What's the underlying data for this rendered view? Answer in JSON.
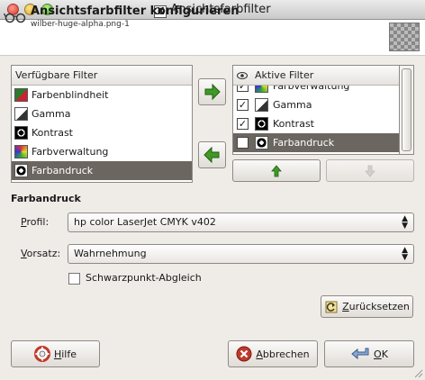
{
  "window": {
    "title": "Ansichtsfarbfilter"
  },
  "header": {
    "title": "Ansichtsfarbfilter konfigurieren",
    "subtitle": "wilber-huge-alpha.png-1"
  },
  "available": {
    "column_header": "Verfügbare Filter",
    "items": [
      {
        "label": "Farbenblindheit",
        "icon": "colorblind-icon",
        "selected": false
      },
      {
        "label": "Gamma",
        "icon": "gamma-icon",
        "selected": false
      },
      {
        "label": "Kontrast",
        "icon": "contrast-icon",
        "selected": false
      },
      {
        "label": "Farbverwaltung",
        "icon": "color-management-icon",
        "selected": false
      },
      {
        "label": "Farbandruck",
        "icon": "proof-icon",
        "selected": true
      }
    ]
  },
  "active": {
    "column_header": "Aktive Filter",
    "items": [
      {
        "label": "Farbverwaltung",
        "checked": true,
        "selected": false
      },
      {
        "label": "Gamma",
        "checked": true,
        "selected": false
      },
      {
        "label": "Kontrast",
        "checked": true,
        "selected": false
      },
      {
        "label": "Farbandruck",
        "checked": true,
        "selected": true
      }
    ]
  },
  "section": {
    "title": "Farbandruck"
  },
  "profil": {
    "label_prefix": "",
    "label_mnemonic": "P",
    "label_rest": "rofil:",
    "value": "hp color LaserJet CMYK v402"
  },
  "vorsatz": {
    "label_mnemonic": "V",
    "label_rest": "orsatz:",
    "value": "Wahrnehmung"
  },
  "black_point": {
    "label": "Schwarzpunkt-Abgleich",
    "checked": false
  },
  "buttons": {
    "reset_mnemonic": "Z",
    "reset_rest": "urücksetzen",
    "help_mnemonic": "H",
    "help_rest": "ilfe",
    "cancel_mnemonic": "A",
    "cancel_rest": "bbrechen",
    "ok_mnemonic": "O",
    "ok_rest": "K"
  },
  "colors": {
    "selection": "#6b6660",
    "arrow_green": "#3f9a24",
    "dialog_bg": "#efebe7"
  }
}
